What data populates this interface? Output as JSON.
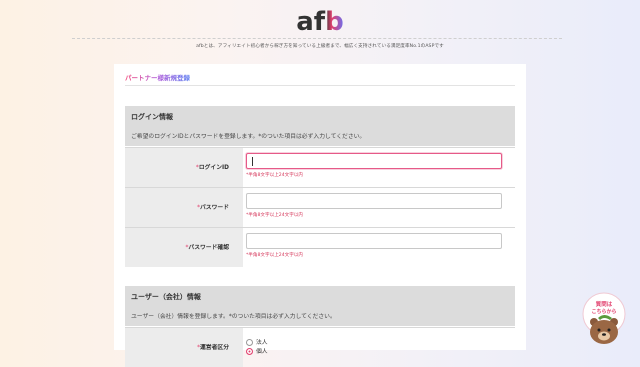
{
  "header": {
    "logo_text": "afb",
    "tagline": "afbとは、アフィリエイト初心者から稼ぎ方を知っている上級者まで、幅広く支持されている満足度率No.1のASPです"
  },
  "page_title": "パートナー様新規登録",
  "login_section": {
    "title": "ログイン情報",
    "description": "ご希望のログインIDとパスワードを登録します。*のついた項目は必ず入力してください。",
    "fields": [
      {
        "required_mark": "*",
        "label": "ログインID",
        "value": "",
        "hint": "*半角8文字以上24文字以内"
      },
      {
        "required_mark": "*",
        "label": "パスワード",
        "value": "",
        "hint": "*半角8文字以上24文字以内"
      },
      {
        "required_mark": "*",
        "label": "パスワード確認",
        "value": "",
        "hint": "*半角8文字以上24文字以内"
      }
    ]
  },
  "user_section": {
    "title": "ユーザー（会社）情報",
    "description": "ユーザー（会社）情報を登録します。*のついた項目は必ず入力してください。",
    "operator_type": {
      "required_mark": "*",
      "label": "運営者区分",
      "options": [
        {
          "label": "法人",
          "checked": false
        },
        {
          "label": "個人",
          "checked": true
        }
      ]
    }
  },
  "mascot": {
    "bubble_text_1": "質問は",
    "bubble_text_2": "こちらから"
  },
  "colors": {
    "accent": "#e2426f",
    "section_bg": "#dcdcdc",
    "label_bg": "#ececec"
  }
}
